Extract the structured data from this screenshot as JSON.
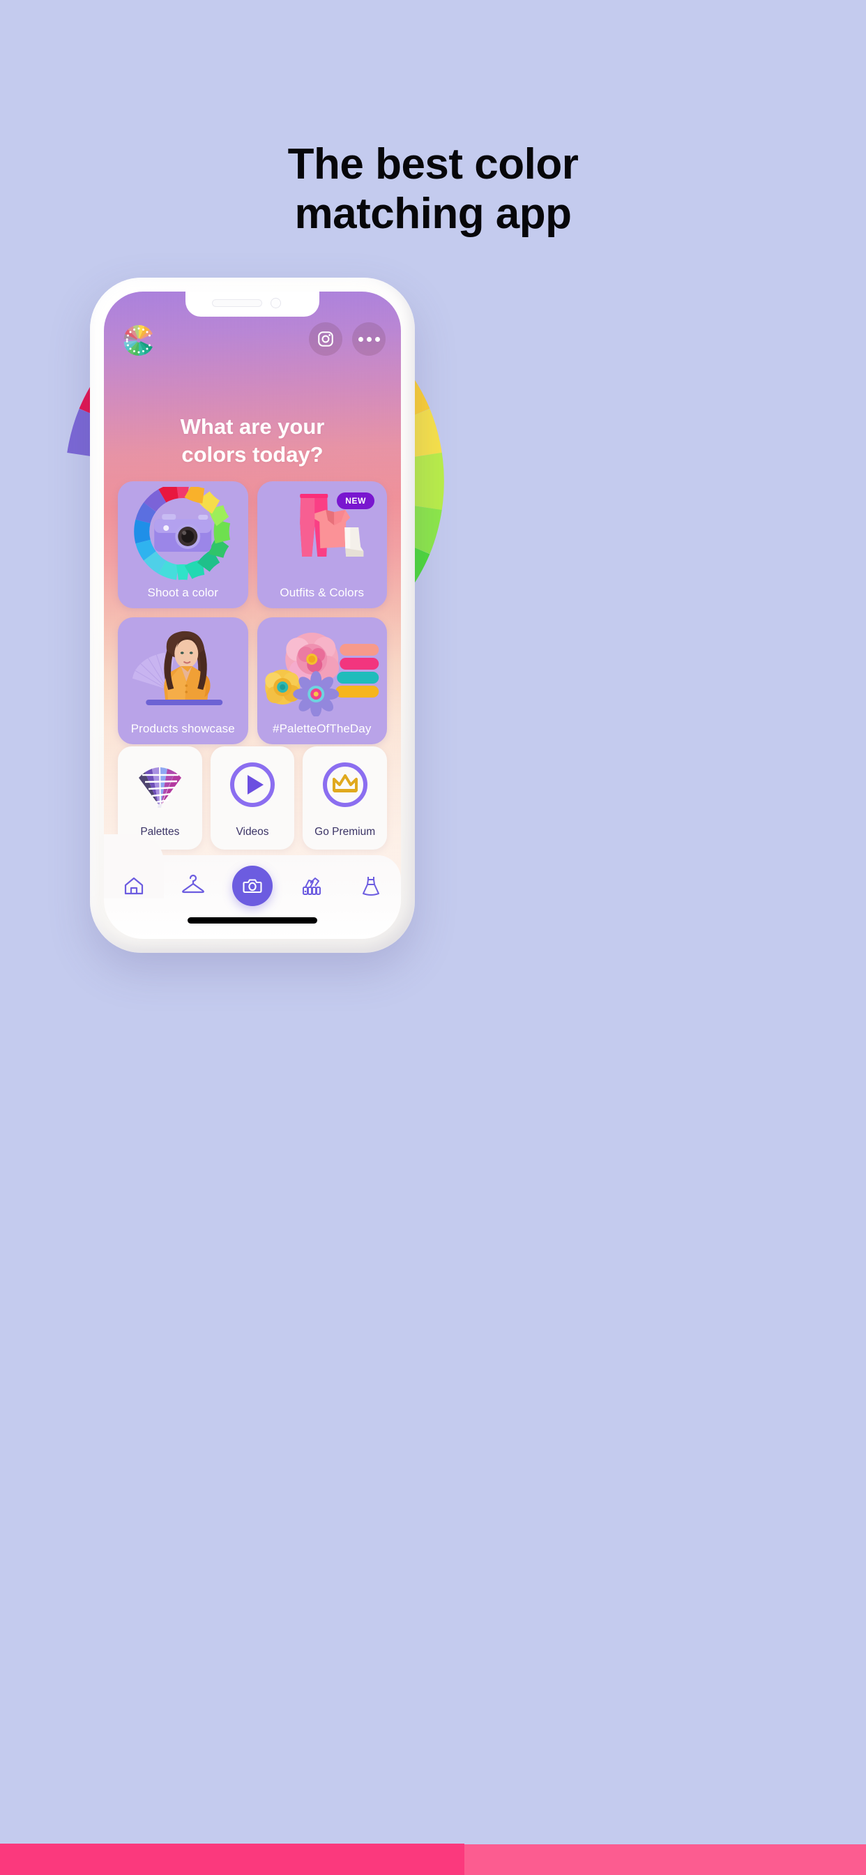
{
  "page": {
    "background_color": "#c4cbee",
    "headline_line1": "The best color",
    "headline_line2": "matching app"
  },
  "color_wheel_arc": {
    "name": "color-wheel-arc",
    "segments": [
      "#7b68d6",
      "#e5124f",
      "#f41e58",
      "#f8336f",
      "#fa3f78",
      "#fb4c85",
      "#f9ab1d",
      "#fbb117",
      "#fcd033",
      "#f7e24a",
      "#b9ee4a",
      "#8ce84a",
      "#4ddb3a",
      "#24cb3f",
      "#1cc84a",
      "#18b8a8",
      "#15adb8"
    ]
  },
  "phone": {
    "notch": {
      "speaker": "speaker-slot",
      "camera": "front-camera"
    },
    "home_indicator": "home-indicator"
  },
  "app": {
    "header": {
      "logo_name": "color-fan-c-logo",
      "instagram_label": "Instagram",
      "more_label": "More options"
    },
    "hero": {
      "line1": "What are your",
      "line2": "colors today?"
    },
    "tiles": [
      {
        "id": "shoot-a-color",
        "label": "Shoot a color",
        "icon": "color-wheel-camera-icon",
        "badge": null
      },
      {
        "id": "outfits-and-colors",
        "label": "Outfits & Colors",
        "icon": "outfit-clothes-icon",
        "badge": "NEW"
      },
      {
        "id": "products-showcase",
        "label": "Products showcase",
        "icon": "model-portrait-icon",
        "badge": null
      },
      {
        "id": "palette-of-the-day",
        "label": "#PaletteOfTheDay",
        "icon": "flowers-palette-icon",
        "badge": null
      }
    ],
    "mini_cards": [
      {
        "id": "palettes",
        "label": "Palettes",
        "icon": "color-swatch-fan-icon"
      },
      {
        "id": "videos",
        "label": "Videos",
        "icon": "play-circle-icon"
      },
      {
        "id": "go-premium",
        "label": "Go Premium",
        "icon": "crown-circle-icon"
      }
    ],
    "nav": [
      {
        "id": "home",
        "icon": "home-icon",
        "active": true
      },
      {
        "id": "wardrobe",
        "icon": "hanger-icon",
        "active": false
      },
      {
        "id": "camera",
        "icon": "camera-icon",
        "active": false
      },
      {
        "id": "palettes",
        "icon": "swatch-book-icon",
        "active": false
      },
      {
        "id": "dress",
        "icon": "dress-icon",
        "active": false
      }
    ]
  },
  "footer_strips": {
    "left_color": "#fb397d",
    "right_color": "#fc5c90"
  },
  "theme": {
    "tile_purple": "#b9a3e8",
    "accent_purple": "#6c5ce0",
    "badge_purple": "#7916cf",
    "mini_text": "#3b3466"
  }
}
